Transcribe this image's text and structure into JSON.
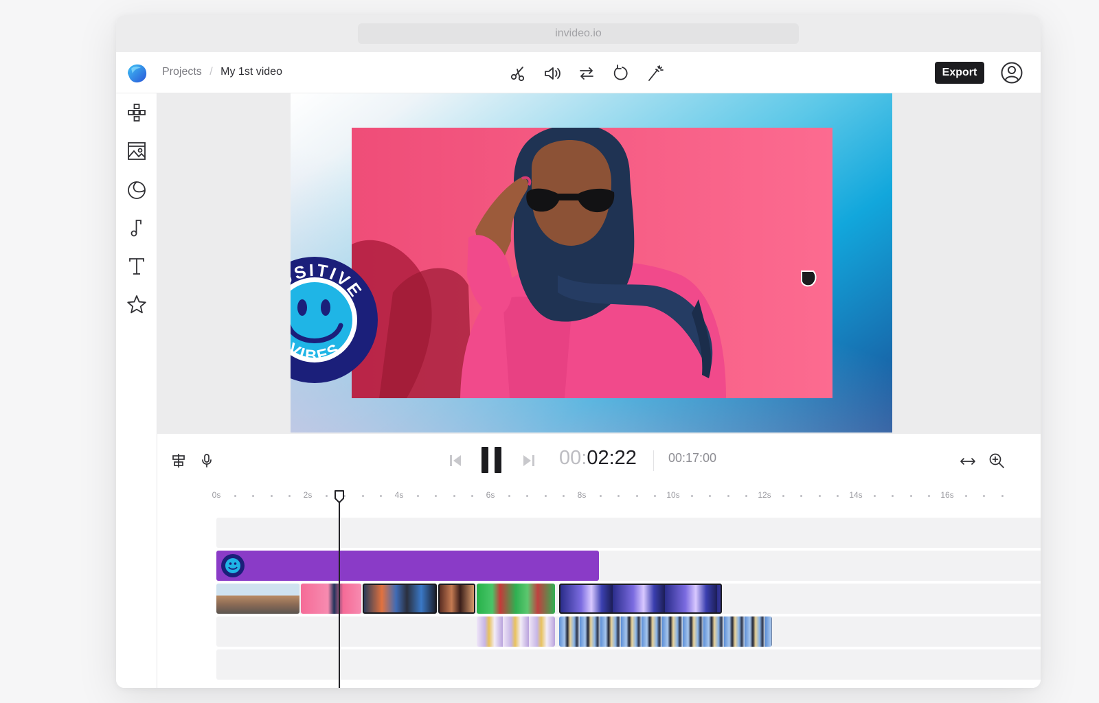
{
  "browser": {
    "url": "invideo.io"
  },
  "header": {
    "breadcrumb": {
      "projects": "Projects",
      "separator": "/",
      "current": "My 1st video"
    },
    "tools": [
      "scissors-icon",
      "volume-icon",
      "swap-icon",
      "rotate-icon",
      "magic-wand-icon"
    ],
    "export_label": "Export"
  },
  "sidebar": {
    "items": [
      "layout-icon",
      "media-icon",
      "sticker-icon",
      "music-icon",
      "text-icon",
      "star-icon"
    ]
  },
  "stage": {
    "sticker_text_top": "POSITIVE",
    "sticker_text_bottom": "VIBES",
    "colors": {
      "photo_bg": "#f65b85",
      "sticker_ring": "#1b1f7a",
      "sticker_face": "#1fb5e6"
    }
  },
  "player": {
    "timecode_dim": "00:",
    "timecode": "02:22",
    "duration": "00:17:00",
    "state": "playing"
  },
  "timeline": {
    "ruler_labels": [
      "0s",
      "2s",
      "4s",
      "6s",
      "8s",
      "10s",
      "12s",
      "14s",
      "16s"
    ],
    "playhead_seconds": 2.7,
    "tracks": [
      {
        "name": "overlay",
        "clips": []
      },
      {
        "name": "sticker",
        "clips": [
          {
            "type": "sticker",
            "start": 0,
            "end": 8.4,
            "color": "#8a3bc7"
          }
        ]
      },
      {
        "name": "video",
        "clips": [
          {
            "start": 0.0,
            "end": 1.85,
            "thumb": "street"
          },
          {
            "start": 1.85,
            "end": 3.2,
            "thumb": "portrait"
          },
          {
            "start": 3.2,
            "end": 4.85,
            "thumb": "sneakers"
          },
          {
            "start": 4.85,
            "end": 5.7,
            "thumb": "floral"
          },
          {
            "start": 5.7,
            "end": 7.45,
            "thumb": "green"
          },
          {
            "start": 7.5,
            "end": 11.1,
            "thumb": "neon"
          }
        ]
      },
      {
        "name": "video-2",
        "clips": [
          {
            "start": 5.7,
            "end": 7.45,
            "thumb": "dancers"
          },
          {
            "start": 7.5,
            "end": 12.2,
            "thumb": "crowd"
          }
        ]
      },
      {
        "name": "audio",
        "clips": []
      }
    ]
  }
}
